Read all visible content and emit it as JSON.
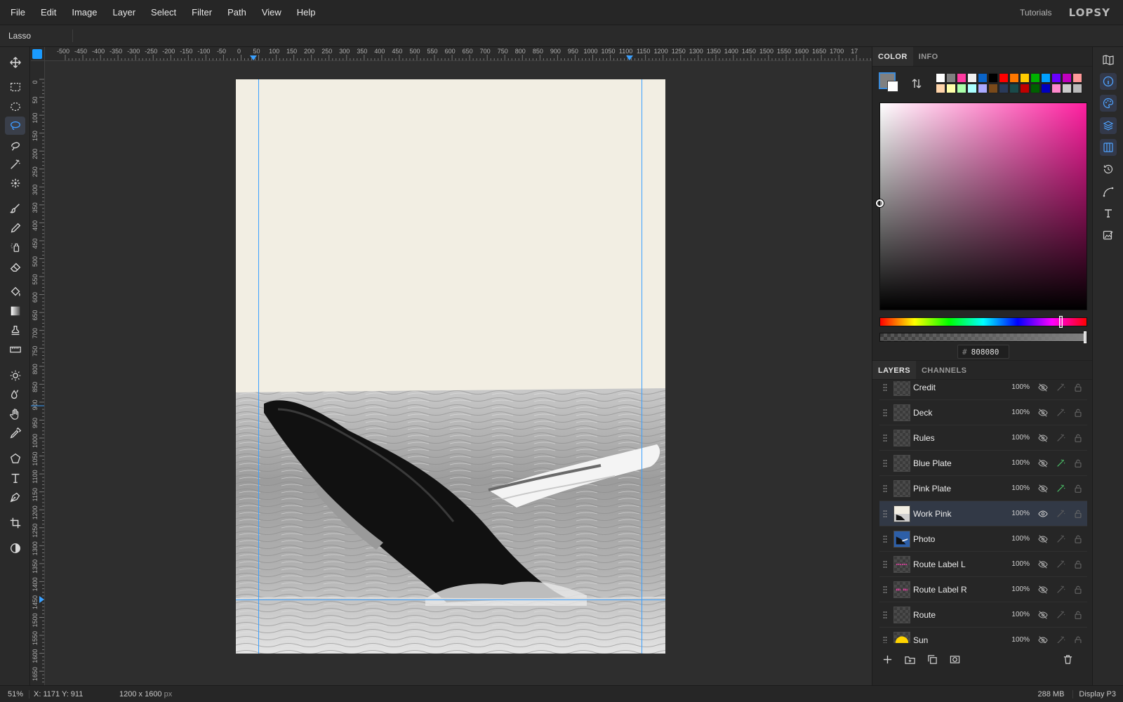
{
  "menubar": {
    "items": [
      "File",
      "Edit",
      "Image",
      "Layer",
      "Select",
      "Filter",
      "Path",
      "View",
      "Help"
    ],
    "tutorials": "Tutorials",
    "logo": "LOPSY"
  },
  "options": {
    "tool_name": "Lasso"
  },
  "toolbar": {
    "active": "lasso-tool",
    "tools": [
      "move",
      "marquee",
      "ellipse-marquee",
      "lasso",
      "quick-selection",
      "magic-wand",
      "object-select",
      "brush",
      "pencil",
      "spray",
      "eraser",
      "bucket",
      "gradient",
      "stamp",
      "ruler",
      "dodge",
      "smudge",
      "hand",
      "eyedropper",
      "polygon",
      "type",
      "pen",
      "crop",
      "contrast"
    ]
  },
  "rulers": {
    "horizontal_labels": [
      "-500",
      "-450",
      "-400",
      "-350",
      "-300",
      "-250",
      "-200",
      "-150",
      "-100",
      "-50",
      "0",
      "50",
      "100",
      "150",
      "200",
      "250",
      "300",
      "350",
      "400",
      "450",
      "500",
      "550",
      "600",
      "650",
      "700",
      "750",
      "800",
      "850",
      "900",
      "950",
      "1000",
      "1050",
      "1100",
      "1150",
      "1200",
      "1250",
      "1300",
      "1350",
      "1400",
      "1450",
      "1500",
      "1550",
      "1600",
      "1650",
      "1700",
      "17"
    ],
    "vertical_labels": [
      "0",
      "50",
      "100",
      "150",
      "200",
      "250",
      "300",
      "350",
      "400",
      "450",
      "500",
      "550",
      "600",
      "650",
      "700",
      "750",
      "800",
      "850",
      "900",
      "950",
      "1000",
      "1050",
      "1100",
      "1150",
      "1200",
      "1250",
      "1300",
      "1350",
      "1400",
      "1450",
      "1500",
      "1550",
      "1600",
      "1650"
    ]
  },
  "color_panel": {
    "tabs": [
      "COLOR",
      "INFO"
    ],
    "active_tab": "COLOR",
    "foreground": "#808080",
    "background": "#ffffff",
    "hex_label": "#",
    "hex_value": "808080",
    "swatches": [
      "#ffffff",
      "#808080",
      "#ff3aa0",
      "#f0f0f0",
      "#0a64c8",
      "#000000",
      "#ff0000",
      "#ff7700",
      "#ffcc00",
      "#00b000",
      "#00a0ff",
      "#6a00ff",
      "#c000c0",
      "#ff9999",
      "#ffd4aa",
      "#ffffaa",
      "#aaffaa",
      "#aaffff",
      "#aaaaff",
      "#7a4a1a",
      "#2a3a5a",
      "#1a4a4a",
      "#c00000",
      "#006000",
      "#0000c0",
      "#ff88cc",
      "#cccccc",
      "#bbbbbb"
    ]
  },
  "layers_panel": {
    "tabs": [
      "LAYERS",
      "CHANNELS"
    ],
    "active_tab": "LAYERS",
    "layers": [
      {
        "name": "Credit",
        "opacity": "100%",
        "visible": false,
        "effect": false,
        "selected": false
      },
      {
        "name": "Deck",
        "opacity": "100%",
        "visible": false,
        "effect": false,
        "selected": false
      },
      {
        "name": "Rules",
        "opacity": "100%",
        "visible": false,
        "effect": false,
        "selected": false
      },
      {
        "name": "Blue Plate",
        "opacity": "100%",
        "visible": false,
        "effect": true,
        "selected": false
      },
      {
        "name": "Pink Plate",
        "opacity": "100%",
        "visible": false,
        "effect": true,
        "selected": false
      },
      {
        "name": "Work Pink",
        "opacity": "100%",
        "visible": true,
        "effect": false,
        "selected": true
      },
      {
        "name": "Photo",
        "opacity": "100%",
        "visible": false,
        "effect": false,
        "selected": false
      },
      {
        "name": "Route Label L",
        "opacity": "100%",
        "visible": false,
        "effect": false,
        "selected": false
      },
      {
        "name": "Route Label R",
        "opacity": "100%",
        "visible": false,
        "effect": false,
        "selected": false
      },
      {
        "name": "Route",
        "opacity": "100%",
        "visible": false,
        "effect": false,
        "selected": false
      },
      {
        "name": "Sun",
        "opacity": "100%",
        "visible": false,
        "effect": false,
        "selected": false
      }
    ]
  },
  "statusbar": {
    "zoom": "51%",
    "coords": "X: 1171 Y: 911",
    "doc_size": "1200 x 1600",
    "doc_unit": "px",
    "memory": "288 MB",
    "profile": "Display P3"
  }
}
